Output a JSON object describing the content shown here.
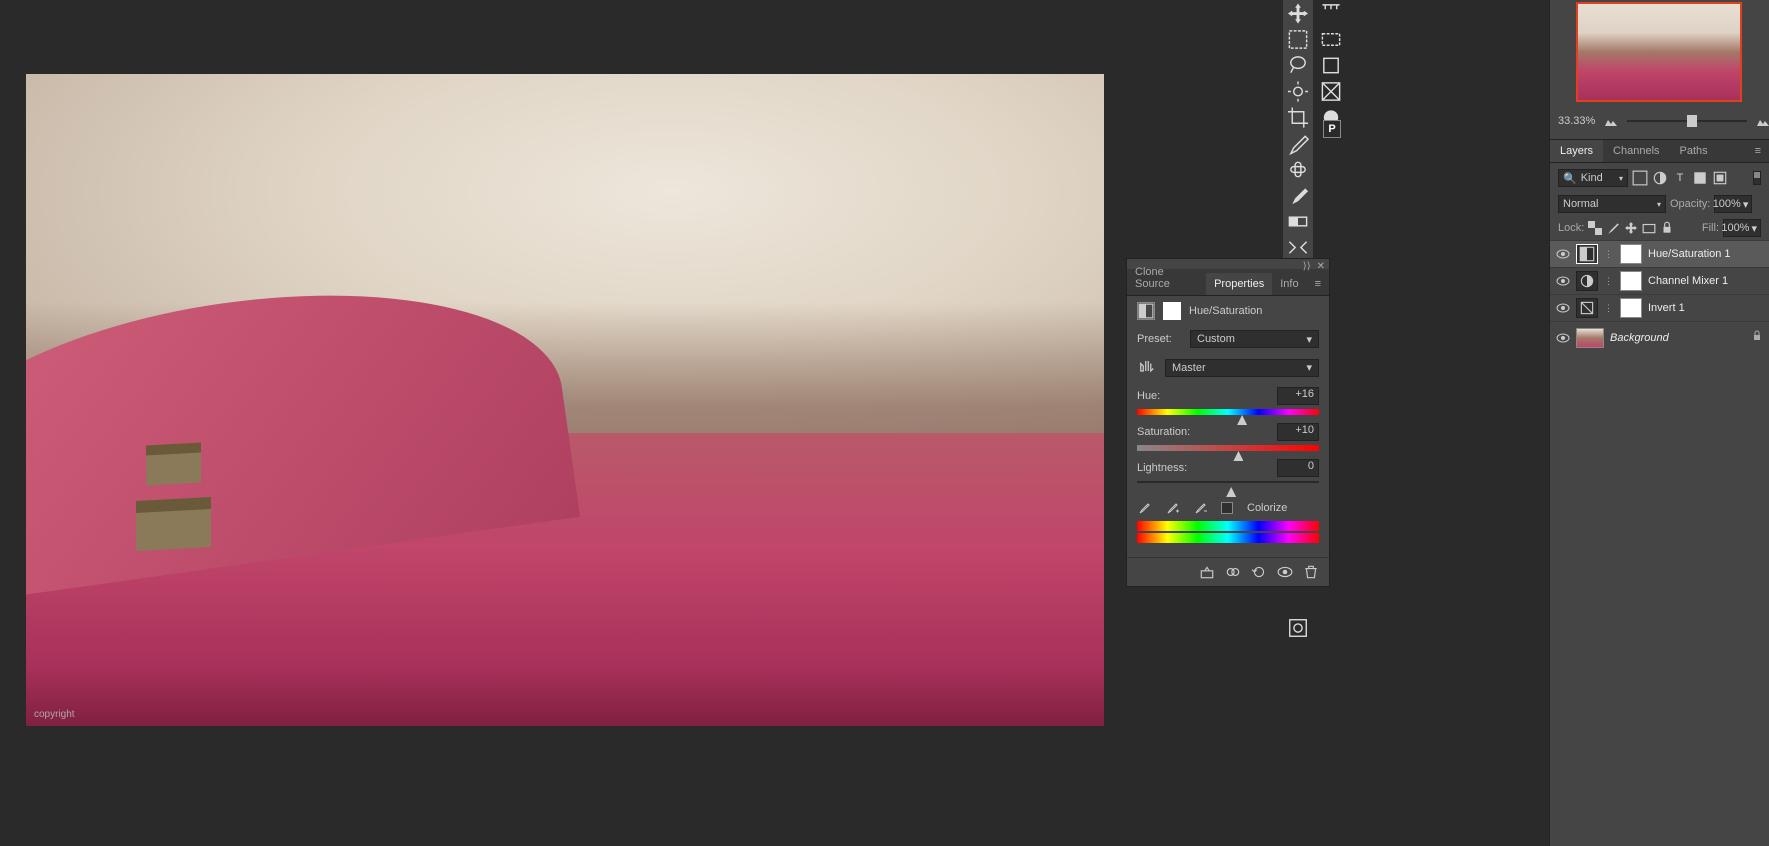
{
  "canvas": {
    "copyright": "copyright"
  },
  "navigator": {
    "zoom": "33.33%"
  },
  "panelTabs": {
    "layers": "Layers",
    "channels": "Channels",
    "paths": "Paths"
  },
  "filter": {
    "kind": "Kind"
  },
  "blend": {
    "mode": "Normal",
    "opacityLabel": "Opacity:",
    "opacity": "100%"
  },
  "lock": {
    "label": "Lock:",
    "fillLabel": "Fill:",
    "fill": "100%"
  },
  "layers": {
    "0": {
      "name": "Hue/Saturation 1"
    },
    "1": {
      "name": "Channel Mixer 1"
    },
    "2": {
      "name": "Invert 1"
    },
    "3": {
      "name": "Background"
    }
  },
  "properties": {
    "tabCloneSource": "Clone Source",
    "tabProperties": "Properties",
    "tabInfo": "Info",
    "title": "Hue/Saturation",
    "presetLabel": "Preset:",
    "preset": "Custom",
    "channel": "Master",
    "hueLabel": "Hue:",
    "hue": "+16",
    "satLabel": "Saturation:",
    "sat": "+10",
    "lightLabel": "Lightness:",
    "light": "0",
    "colorize": "Colorize"
  }
}
